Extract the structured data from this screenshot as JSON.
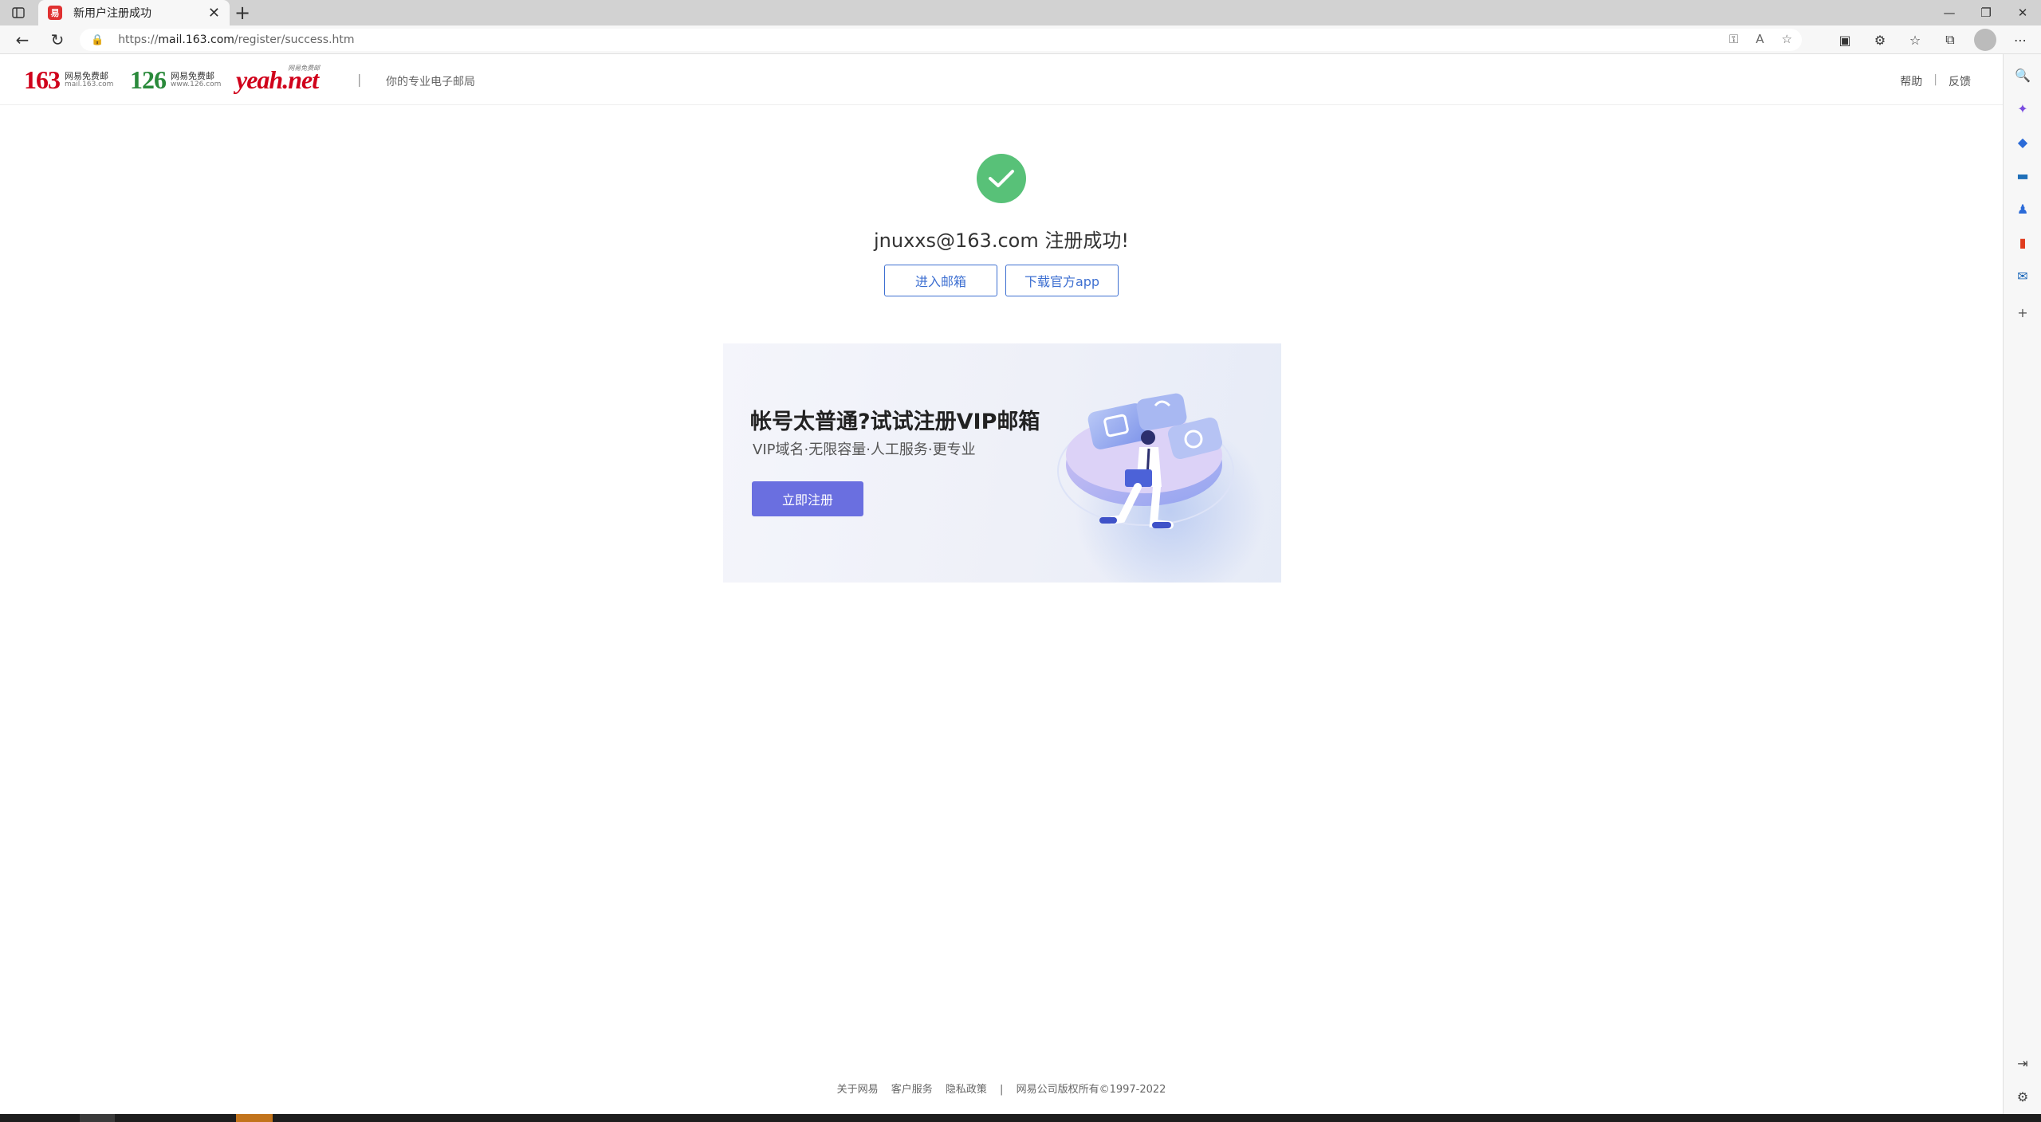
{
  "browser": {
    "tab_title": "新用户注册成功",
    "favicon_text": "易",
    "new_tab": "+",
    "url_prefix": "https://",
    "url_host": "mail.163.com",
    "url_path": "/register/success.htm"
  },
  "header": {
    "logo_163": {
      "num": "163",
      "title": "网易免费邮",
      "url": "mail.163.com",
      "color": "#d0021b"
    },
    "logo_126": {
      "num": "126",
      "title": "网易免费邮",
      "url": "www.126.com",
      "color": "#2a8a3b"
    },
    "logo_yeah": {
      "text": "yeah.net",
      "tag": "网易免费邮"
    },
    "divider": "|",
    "slogan": "你的专业电子邮局",
    "help": "帮助",
    "sep": "|",
    "feedback": "反馈"
  },
  "main": {
    "success_message": "jnuxxs@163.com 注册成功!",
    "enter_mailbox": "进入邮箱",
    "download_app": "下载官方app"
  },
  "banner": {
    "title": "帐号太普通?试试注册VIP邮箱",
    "subtitle": "VIP域名·无限容量·人工服务·更专业",
    "button": "立即注册"
  },
  "footer": {
    "about": "关于网易",
    "service": "客户服务",
    "privacy": "隐私政策",
    "sep": "|",
    "copyright": "网易公司版权所有©1997-2022"
  },
  "colors": {
    "success_green": "#58c178",
    "link_blue": "#3d6fd1",
    "vip_purple": "#6a6fe0",
    "brand_red": "#d0021b"
  }
}
